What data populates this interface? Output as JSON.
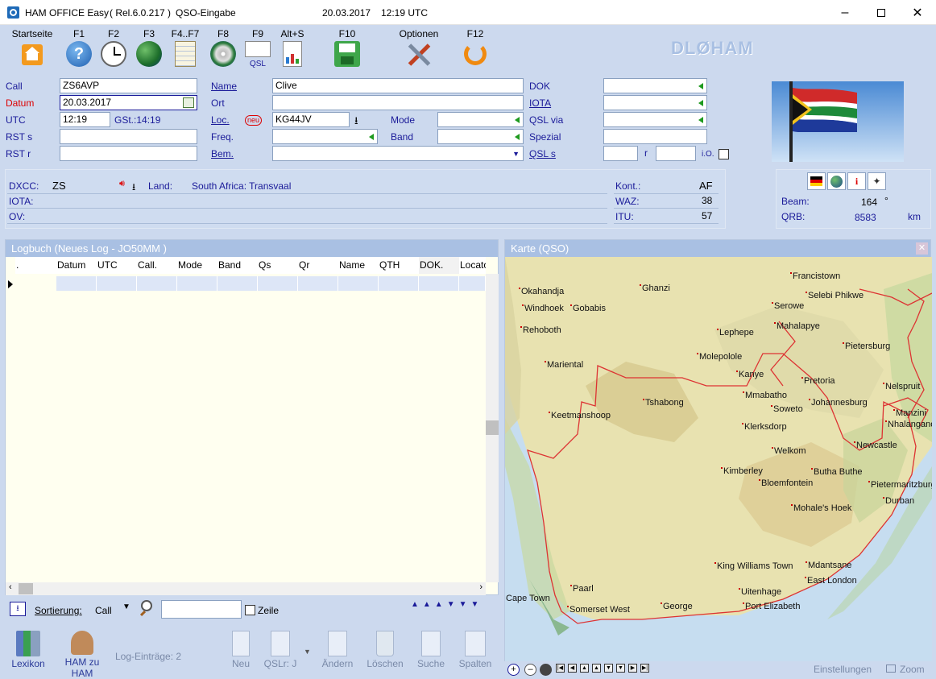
{
  "window": {
    "app_title": "HAM OFFICE Easy",
    "release": "( Rel.6.0.217 )",
    "mode": "QSO-Eingabe",
    "date": "20.03.2017",
    "time": "12:19 UTC"
  },
  "toolbar": {
    "items": [
      {
        "label": "Startseite",
        "icon": "home-icon"
      },
      {
        "label": "F1",
        "icon": "help-icon"
      },
      {
        "label": "F2",
        "icon": "clock-icon"
      },
      {
        "label": "F3",
        "icon": "globe-icon"
      },
      {
        "label": "F4..F7",
        "icon": "notepad-icon"
      },
      {
        "label": "F8",
        "icon": "cd-globe-icon"
      },
      {
        "label": "F9",
        "icon": "qsl-card-icon",
        "sub": "QSL"
      },
      {
        "label": "Alt+S",
        "icon": "document-chart-icon"
      },
      {
        "label": "F10",
        "icon": "save-icon"
      },
      {
        "label": "Optionen",
        "icon": "tools-icon"
      },
      {
        "label": "F12",
        "icon": "refresh-icon"
      }
    ],
    "callsign": "DLØHAM"
  },
  "form": {
    "call_label": "Call",
    "call_value": "ZS6AVP",
    "datum_label": "Datum",
    "datum_value": "20.03.2017",
    "utc_label": "UTC",
    "utc_value": "12:19",
    "gst": "GSt.:14:19",
    "rsts_label": "RST s",
    "rstr_label": "RST r",
    "name_label": "Name",
    "name_value": "Clive",
    "ort_label": "Ort",
    "loc_label": "Loc.",
    "neu_badge": "neu",
    "loc_value": "KG44JV",
    "freq_label": "Freq.",
    "bem_label": "Bem.",
    "mode_label": "Mode",
    "band_label": "Band",
    "dok_label": "DOK",
    "iota_label": "IOTA",
    "qslvia_label": "QSL via",
    "spezial_label": "Spezial",
    "qsls_label": "QSL s",
    "r_label": "r",
    "io_label": "i.O."
  },
  "info": {
    "dxcc_label": "DXCC:",
    "dxcc_value": "ZS",
    "land_label": "Land:",
    "land_value": "South Africa: Transvaal",
    "iota_label": "IOTA:",
    "ov_label": "OV:",
    "kont_label": "Kont.:",
    "kont_value": "AF",
    "waz_label": "WAZ:",
    "waz_value": "38",
    "itu_label": "ITU:",
    "itu_value": "57",
    "beam_label": "Beam:",
    "beam_value": "164",
    "beam_unit": "°",
    "qrb_label": "QRB:",
    "qrb_value": "8583",
    "qrb_unit": "km"
  },
  "logbook": {
    "title": "Logbuch  (Neues Log - JO50MM )",
    "columns": [
      ".",
      "Datum",
      "UTC",
      "Call.",
      "Mode",
      "Band",
      "Qs",
      "Qr",
      "Name",
      "QTH",
      "DOK.",
      "Locato"
    ],
    "sort_label": "Sortierung:",
    "sort_value": "Call",
    "zeile_label": "Zeile",
    "lexikon": "Lexikon",
    "ham_zu_ham": "HAM zu HAM",
    "log_entries": "Log-Einträge: 2",
    "neu": "Neu",
    "qslr": "QSLr: J",
    "aendern": "Ändern",
    "loeschen": "Löschen",
    "suche": "Suche",
    "spalten": "Spalten"
  },
  "map": {
    "title": "Karte (QSO)",
    "einstellungen": "Einstellungen",
    "zoom": "Zoom",
    "cities": [
      {
        "name": "Francistown"
      },
      {
        "name": "Okahandja"
      },
      {
        "name": "Ghanzi"
      },
      {
        "name": "Selebi Phikwe"
      },
      {
        "name": "Windhoek"
      },
      {
        "name": "Gobabis"
      },
      {
        "name": "Serowe"
      },
      {
        "name": "Mahalapye"
      },
      {
        "name": "Rehoboth"
      },
      {
        "name": "Lephepe"
      },
      {
        "name": "Pietersburg"
      },
      {
        "name": "Molepolole"
      },
      {
        "name": "Mariental"
      },
      {
        "name": "Kanye"
      },
      {
        "name": "Pretoria"
      },
      {
        "name": "Nelspruit"
      },
      {
        "name": "Mmabatho"
      },
      {
        "name": "Tshabong"
      },
      {
        "name": "Johannesburg"
      },
      {
        "name": "Soweto"
      },
      {
        "name": "Keetmanshoop"
      },
      {
        "name": "Manzini"
      },
      {
        "name": "Klerksdorp"
      },
      {
        "name": "Nhalangano"
      },
      {
        "name": "Newcastle"
      },
      {
        "name": "Welkom"
      },
      {
        "name": "Kimberley"
      },
      {
        "name": "Butha Buthe"
      },
      {
        "name": "Bloemfontein"
      },
      {
        "name": "Pietermaritzburg"
      },
      {
        "name": "Durban"
      },
      {
        "name": "Mohale's Hoek"
      },
      {
        "name": "King Williams Town"
      },
      {
        "name": "Mdantsane"
      },
      {
        "name": "East London"
      },
      {
        "name": "Paarl"
      },
      {
        "name": "Uitenhage"
      },
      {
        "name": "Cape Town"
      },
      {
        "name": "George"
      },
      {
        "name": "Port Elizabeth"
      },
      {
        "name": "Somerset West"
      }
    ]
  }
}
